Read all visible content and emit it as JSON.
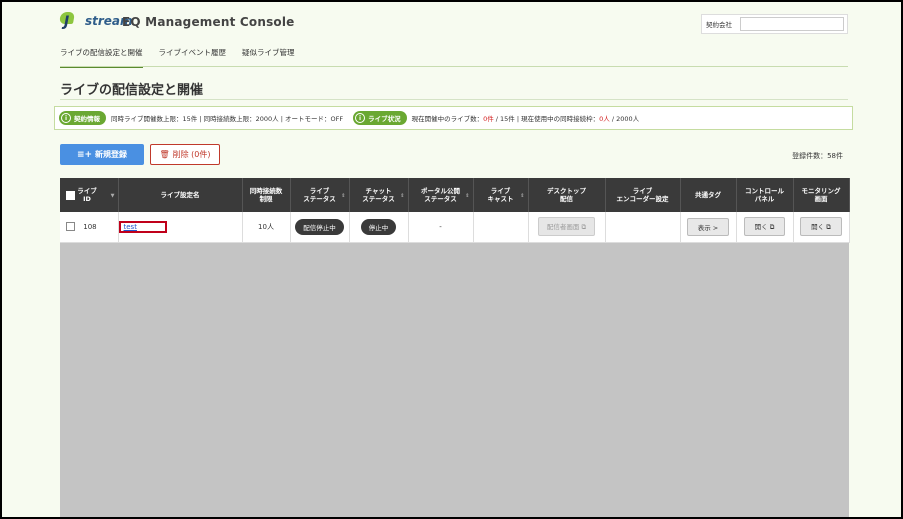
{
  "header": {
    "logo_text": "stream",
    "logo_j": "J",
    "app_title": "EQ Management Console",
    "contract_label": "契約会社",
    "contract_value": ""
  },
  "nav": {
    "items": [
      {
        "label": "ライブの配信設定と開催",
        "active": true
      },
      {
        "label": "ライブイベント履歴",
        "active": false
      },
      {
        "label": "疑似ライブ管理",
        "active": false
      }
    ]
  },
  "page_title": "ライブの配信設定と開催",
  "status": {
    "contract_pill": "契約情報",
    "contract_text": "同時ライブ開催数上限：15件 | 同時接続数上限：2000人 | オートモード：OFF",
    "live_pill": "ライブ状況",
    "live_prefix": "現在開催中のライブ数：",
    "live_count": "0件",
    "live_mid": " / 15件 | 現在使用中の同時接続枠：",
    "live_conn": "0人",
    "live_suffix": " / 2000人"
  },
  "actions": {
    "new_label": "新規登録",
    "delete_label": "削除 (0件)",
    "total_count": "登録件数：58件"
  },
  "table": {
    "headers": [
      "ライブ\nID",
      "ライブ設定名",
      "同時接続数\n制限",
      "ライブ\nステータス",
      "チャット\nステータス",
      "ポータル公開\nステータス",
      "ライブ\nキャスト",
      "デスクトップ\n配信",
      "ライブ\nエンコーダー設定",
      "共通タグ",
      "コントロール\nパネル",
      "モニタリング\n画面"
    ],
    "rows": [
      {
        "id": "108",
        "name": "test",
        "limit": "10人",
        "live_status": "配信停止中",
        "chat_status": "停止中",
        "portal_status": "-",
        "cast": "",
        "desktop": "配信者画面 ⧉",
        "encoder": "",
        "tag": "表示 >",
        "control": "開く ⧉",
        "monitor": "開く ⧉"
      }
    ]
  },
  "colors": {
    "accent_green": "#6aa832",
    "primary_blue": "#4a90e2",
    "danger_red": "#c0392b"
  }
}
